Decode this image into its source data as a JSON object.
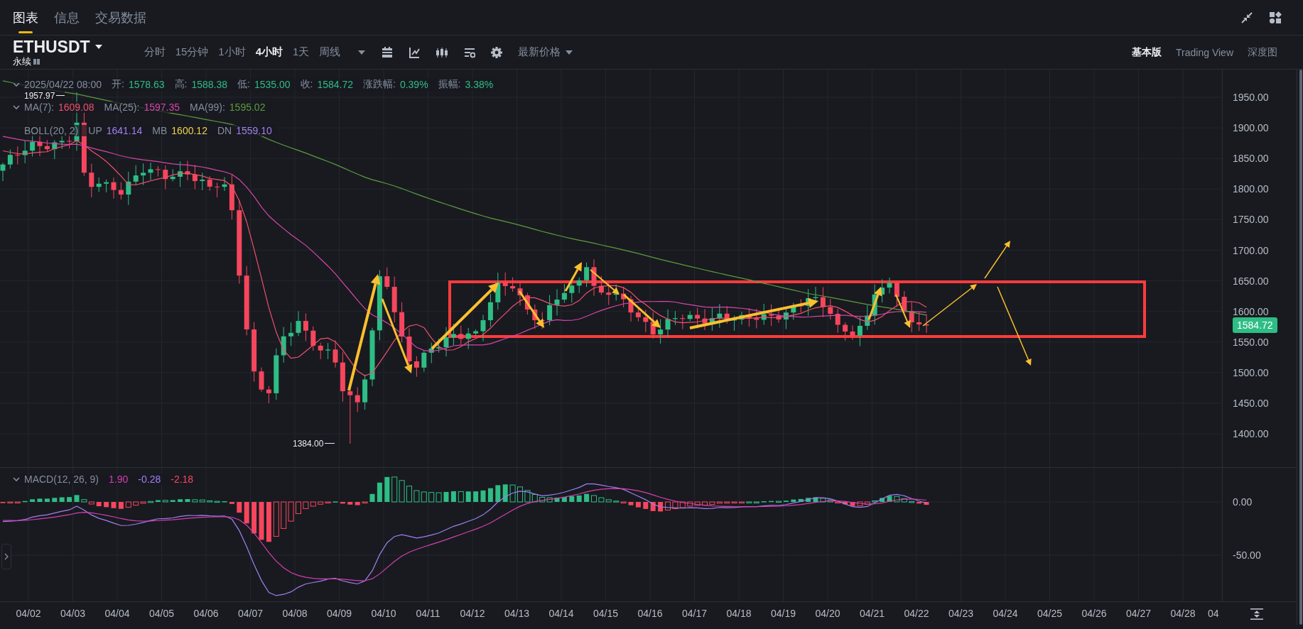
{
  "tabs": [
    {
      "label": "图表",
      "selected": true
    },
    {
      "label": "信息",
      "selected": false
    },
    {
      "label": "交易数据",
      "selected": false
    }
  ],
  "symbol": {
    "name": "ETHUSDT",
    "contract": "永续"
  },
  "intervals": [
    {
      "label": "分时",
      "selected": false
    },
    {
      "label": "15分钟",
      "selected": false
    },
    {
      "label": "1小时",
      "selected": false
    },
    {
      "label": "4小时",
      "selected": true
    },
    {
      "label": "1天",
      "selected": false
    },
    {
      "label": "周线",
      "selected": false
    }
  ],
  "price_source": "最新价格",
  "views": [
    {
      "label": "基本版",
      "selected": true
    },
    {
      "label": "Trading View",
      "selected": false
    },
    {
      "label": "深度图",
      "selected": false
    }
  ],
  "legend": {
    "datetime": "2025/04/22 08:00",
    "fields": [
      {
        "label": "开:",
        "value": "1578.63"
      },
      {
        "label": "高:",
        "value": "1588.38"
      },
      {
        "label": "低:",
        "value": "1535.00"
      },
      {
        "label": "收:",
        "value": "1584.72"
      },
      {
        "label": "涨跌幅:",
        "value": "0.39%"
      },
      {
        "label": "振幅:",
        "value": "3.38%"
      }
    ]
  },
  "moving_averages": [
    {
      "label": "MA(7):",
      "value": "1609.08",
      "color": "#f0506e"
    },
    {
      "label": "MA(25):",
      "value": "1597.35",
      "color": "#d845a8"
    },
    {
      "label": "MA(99):",
      "value": "1595.02",
      "color": "#5e9b3c"
    }
  ],
  "bollinger": {
    "label": "BOLL(20, 2)",
    "bands": [
      {
        "label": "UP",
        "value": "1641.14",
        "color": "#a27ff0"
      },
      {
        "label": "MB",
        "value": "1600.12",
        "color": "#f0d34a"
      },
      {
        "label": "DN",
        "value": "1559.10",
        "color": "#a27ff0"
      }
    ]
  },
  "price_axis": [
    "1950.00",
    "1900.00",
    "1850.00",
    "1800.00",
    "1750.00",
    "1700.00",
    "1650.00",
    "1600.00",
    "1550.00",
    "1500.00",
    "1450.00",
    "1400.00"
  ],
  "last_price": "1584.72",
  "high_marker": "1957.97",
  "low_marker": "1384.00",
  "macd": {
    "label": "MACD(12, 26, 9)",
    "values": [
      {
        "value": "1.90",
        "color": "#d63fae"
      },
      {
        "value": "-0.28",
        "color": "#a27ff0"
      },
      {
        "value": "-2.18",
        "color": "#f6465d"
      }
    ],
    "axis": [
      "0.00",
      "-50.00"
    ]
  },
  "date_axis": [
    "04/02",
    "04/03",
    "04/04",
    "04/05",
    "04/06",
    "04/07",
    "04/08",
    "04/09",
    "04/10",
    "04/11",
    "04/12",
    "04/13",
    "04/14",
    "04/15",
    "04/16",
    "04/17",
    "04/18",
    "04/19",
    "04/20",
    "04/21",
    "04/22",
    "04/23",
    "04/24",
    "04/25",
    "04/26",
    "04/27",
    "04/28",
    "04"
  ]
}
